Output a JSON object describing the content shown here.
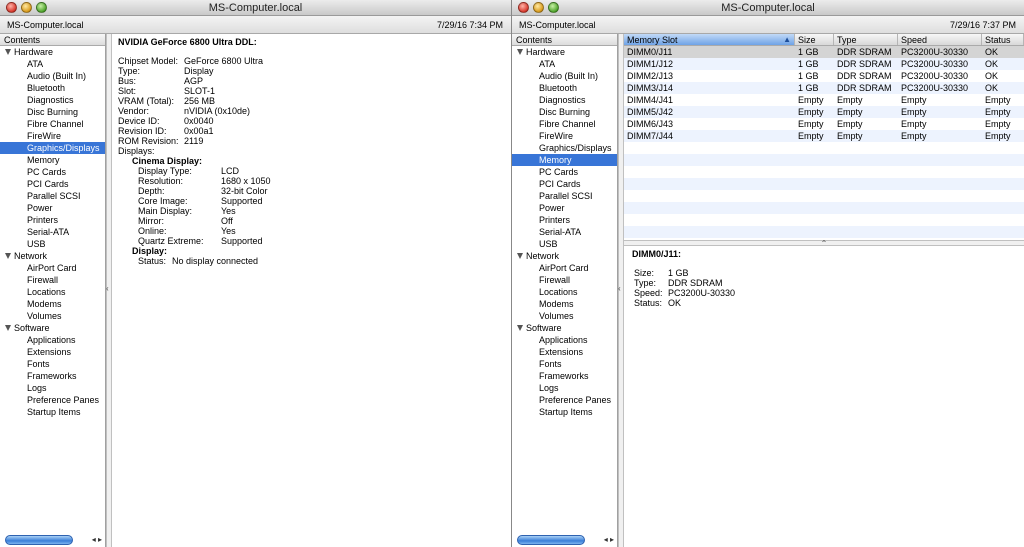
{
  "left": {
    "title": "MS-Computer.local",
    "host": "MS-Computer.local",
    "date": "7/29/16 7:34 PM",
    "detail": {
      "heading": "NVIDIA GeForce 6800 Ultra DDL:",
      "props": [
        {
          "k": "Chipset Model:",
          "v": "GeForce 6800 Ultra"
        },
        {
          "k": "Type:",
          "v": "Display"
        },
        {
          "k": "Bus:",
          "v": "AGP"
        },
        {
          "k": "Slot:",
          "v": "SLOT-1"
        },
        {
          "k": "VRAM (Total):",
          "v": "256 MB"
        },
        {
          "k": "Vendor:",
          "v": "nVIDIA (0x10de)"
        },
        {
          "k": "Device ID:",
          "v": "0x0040"
        },
        {
          "k": "Revision ID:",
          "v": "0x00a1"
        },
        {
          "k": "ROM Revision:",
          "v": "2119"
        }
      ],
      "displays_label": "Displays:",
      "cinema_heading": "Cinema Display:",
      "cinema_props": [
        {
          "k": "Display Type:",
          "v": "LCD"
        },
        {
          "k": "Resolution:",
          "v": "1680 x 1050"
        },
        {
          "k": "Depth:",
          "v": "32-bit Color"
        },
        {
          "k": "Core Image:",
          "v": "Supported"
        },
        {
          "k": "Main Display:",
          "v": "Yes"
        },
        {
          "k": "Mirror:",
          "v": "Off"
        },
        {
          "k": "Online:",
          "v": "Yes"
        },
        {
          "k": "Quartz Extreme:",
          "v": "Supported"
        }
      ],
      "display2_heading": "Display:",
      "status_label": "Status:",
      "status_value": "No display connected"
    }
  },
  "right": {
    "title": "MS-Computer.local",
    "host": "MS-Computer.local",
    "date": "7/29/16 7:37 PM",
    "table": {
      "headers": [
        "Memory Slot",
        "Size",
        "Type",
        "Speed",
        "Status"
      ],
      "rows": [
        [
          "DIMM0/J11",
          "1 GB",
          "DDR SDRAM",
          "PC3200U-30330",
          "OK"
        ],
        [
          "DIMM1/J12",
          "1 GB",
          "DDR SDRAM",
          "PC3200U-30330",
          "OK"
        ],
        [
          "DIMM2/J13",
          "1 GB",
          "DDR SDRAM",
          "PC3200U-30330",
          "OK"
        ],
        [
          "DIMM3/J14",
          "1 GB",
          "DDR SDRAM",
          "PC3200U-30330",
          "OK"
        ],
        [
          "DIMM4/J41",
          "Empty",
          "Empty",
          "Empty",
          "Empty"
        ],
        [
          "DIMM5/J42",
          "Empty",
          "Empty",
          "Empty",
          "Empty"
        ],
        [
          "DIMM6/J43",
          "Empty",
          "Empty",
          "Empty",
          "Empty"
        ],
        [
          "DIMM7/J44",
          "Empty",
          "Empty",
          "Empty",
          "Empty"
        ]
      ]
    },
    "detail": {
      "heading": "DIMM0/J11:",
      "props": [
        {
          "k": "Size:",
          "v": "1 GB"
        },
        {
          "k": "Type:",
          "v": "DDR SDRAM"
        },
        {
          "k": "Speed:",
          "v": "PC3200U-30330"
        },
        {
          "k": "Status:",
          "v": "OK"
        }
      ]
    }
  },
  "sidebar": {
    "header": "Contents",
    "groups": [
      {
        "name": "Hardware",
        "items": [
          "ATA",
          "Audio (Built In)",
          "Bluetooth",
          "Diagnostics",
          "Disc Burning",
          "Fibre Channel",
          "FireWire",
          "Graphics/Displays",
          "Memory",
          "PC Cards",
          "PCI Cards",
          "Parallel SCSI",
          "Power",
          "Printers",
          "Serial-ATA",
          "USB"
        ]
      },
      {
        "name": "Network",
        "items": [
          "AirPort Card",
          "Firewall",
          "Locations",
          "Modems",
          "Volumes"
        ]
      },
      {
        "name": "Software",
        "items": [
          "Applications",
          "Extensions",
          "Fonts",
          "Frameworks",
          "Logs",
          "Preference Panes",
          "Startup Items"
        ]
      }
    ],
    "left_selected": "Graphics/Displays",
    "right_selected": "Memory"
  },
  "colors": {
    "selection": "#3875d7",
    "row_alt": "#edf3fe"
  }
}
